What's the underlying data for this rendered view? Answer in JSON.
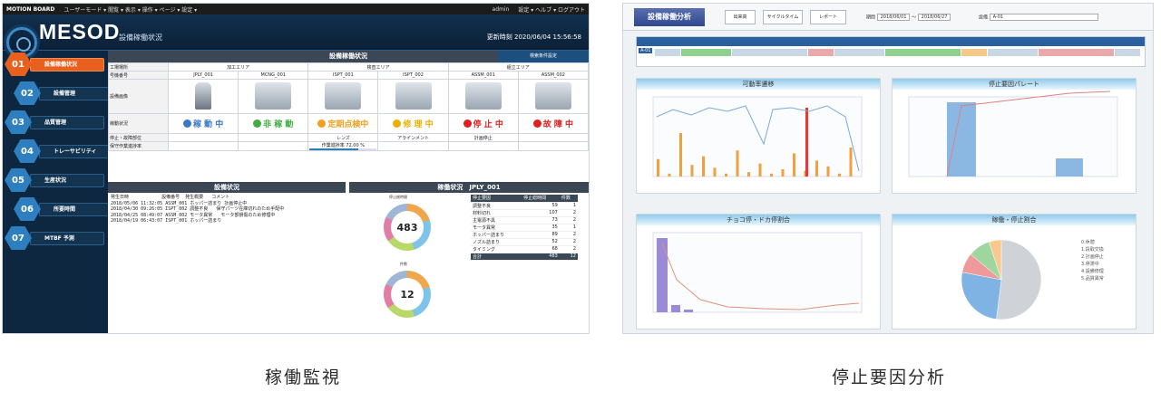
{
  "captions": {
    "left": "稼働監視",
    "right": "停止要因分析"
  },
  "left": {
    "topbar": {
      "logo": "MOTION BOARD",
      "menus": "ユーザーモード ▾ 閲覧 ▾ 表示 ▾ 操作 ▾ ページ ▾ 設定 ▾",
      "user": "admin",
      "settings": "設定 ▾ ヘルプ ▾ ログアウト"
    },
    "brand": "MESOD",
    "subtitle": "設備稼働状況",
    "clock": "更新時刻 2020/06/04 15:56:58",
    "menu": [
      {
        "num": "01",
        "label": "設備稼働状況",
        "active": true
      },
      {
        "num": "02",
        "label": "設備管理",
        "active": false
      },
      {
        "num": "03",
        "label": "品質管理",
        "active": false
      },
      {
        "num": "04",
        "label": "トレーサビリティ",
        "active": false
      },
      {
        "num": "05",
        "label": "生産状況",
        "active": false
      },
      {
        "num": "06",
        "label": "所要時間",
        "active": false
      },
      {
        "num": "07",
        "label": "MTBF 予測",
        "active": false
      }
    ],
    "panel_title": "設備稼働状況",
    "panel_button": "検索条件設定",
    "rows": {
      "area_label": "工場場所",
      "code_label": "号機番号",
      "image_label": "設備画像",
      "status_label": "稼動状況",
      "stop_label": "停止・故障部位",
      "maint_label": "保守作業進捗率"
    },
    "areas": [
      "加工エリア",
      "検査エリア",
      "組立エリア"
    ],
    "machines": [
      {
        "code": "JPLY_001",
        "status": "稼 動 中",
        "color": "#3a78c6",
        "stop": ""
      },
      {
        "code": "MCNG_001",
        "status": "非 稼 動",
        "color": "#3fae3f",
        "stop": ""
      },
      {
        "code": "ISPT_001",
        "status": "定期点検中",
        "color": "#f0a020",
        "stop": "レンズ"
      },
      {
        "code": "ISPT_002",
        "status": "修 理 中",
        "color": "#e8b000",
        "stop": "アラインメント"
      },
      {
        "code": "ASSM_001",
        "status": "停 止 中",
        "color": "#e02020",
        "stop": "計画停止"
      },
      {
        "code": "ASSM_002",
        "status": "故 障 中",
        "color": "#e02020",
        "stop": ""
      }
    ],
    "maint": {
      "label": "作業進捗率",
      "value": "72.00",
      "unit": "%"
    },
    "log_title": "設備状況",
    "log_header": "発生日時            設備番号  発生概要   コメント",
    "log_rows": [
      "2018/05/06 11:32:05 ASSM_001 ホッパー詰まり 計画停止中",
      "2018/04/30 09:26:05 ISPT_002 調整不良   保守パーツ在庫切れのため手配中",
      "2018/04/25 08:49:07 ASSM_002 モータ異常   モータ部損傷のため修理中",
      "2018/04/19 06:43:07 ISPT_001 ホッパー詰まり"
    ],
    "ops_title": "稼働状況　JPLY_001",
    "donut1": {
      "title": "停止総時間",
      "value": "483"
    },
    "donut2": {
      "title": "件数",
      "value": "12"
    },
    "ops_table": {
      "headers": [
        "停止要因",
        "停止総時間",
        "件数"
      ],
      "rows": [
        [
          "調整不良",
          "59",
          "1"
        ],
        [
          "材料切れ",
          "107",
          "2"
        ],
        [
          "主電源不具",
          "73",
          "2"
        ],
        [
          "モータ異常",
          "35",
          "1"
        ],
        [
          "ホッパー詰まり",
          "89",
          "2"
        ],
        [
          "ノズル詰まり",
          "52",
          "2"
        ],
        [
          "タイミング",
          "68",
          "2"
        ],
        [
          "合計",
          "483",
          "12"
        ]
      ]
    }
  },
  "right": {
    "title": "設備稼働分析",
    "buttons": [
      "出来高",
      "サイクルタイム",
      "レポート"
    ],
    "filter": {
      "from_label": "期間",
      "from": "2018/06/01",
      "to_label": "～",
      "to": "2018/06/27",
      "machine_label": "設備",
      "machine": "A-01"
    },
    "timeline_label": "A-01",
    "panels": [
      "可動率遷移",
      "停止要因パレート",
      "チョコ停・ドカ停割合",
      "稼働・停止割合"
    ],
    "pie_legend": [
      "0.休憩",
      "1.段取交換",
      "2.計画停止",
      "3.停滞中",
      "4.設備修理",
      "5.品質異常"
    ]
  }
}
